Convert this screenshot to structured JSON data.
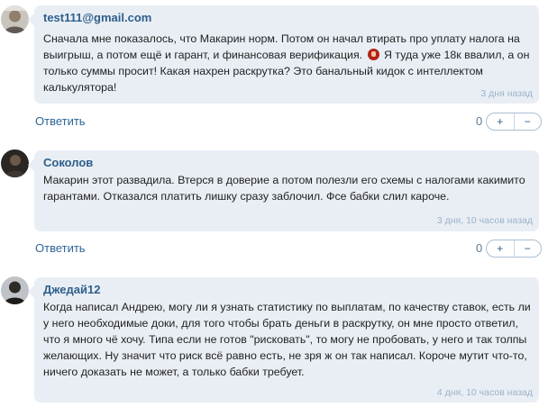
{
  "comments": [
    {
      "author": "test111@gmail.com",
      "text_before_emoji": "Сначала мне показалось, что Макарин норм. Потом он начал втирать про уплату налога на выигрыш, а потом ещё и гарант, и финансовая верификация. ",
      "emoji": "angry-face",
      "text_after_emoji": " Я туда уже 18к ввалил, а он только суммы просит! Какая нахрен раскрутка? Это банальный кидок с интеллектом калькулятора!",
      "time": "3 дня назад",
      "reply_label": "Ответить",
      "votes": "0",
      "plus": "+",
      "minus": "−"
    },
    {
      "author": "Соколов",
      "text": "Макарин этот развадила. Втерся в доверие а потом полезли его схемы с налогами какимито гарантами. Отказался платить лишку сразу заблочил. Фсе бабки слил кароче.",
      "time": "3 дня, 10 часов назад",
      "reply_label": "Ответить",
      "votes": "0",
      "plus": "+",
      "minus": "−"
    },
    {
      "author": "Джедай12",
      "text": "Когда написал Андрею, могу ли я узнать статистику по выплатам, по качеству ставок, есть ли у него необходимые доки, для того чтобы брать деньги в раскрутку, он мне просто ответил, что я много чё хочу. Типа если не готов \"рисковать\", то могу не пробовать, у него и так толпы желающих. Ну значит что риск всё равно есть, не зря ж он так написал. Короче мутит что-то, ничего доказать не может, а только бабки требует.",
      "time": "4 дня, 10 часов назад"
    }
  ]
}
